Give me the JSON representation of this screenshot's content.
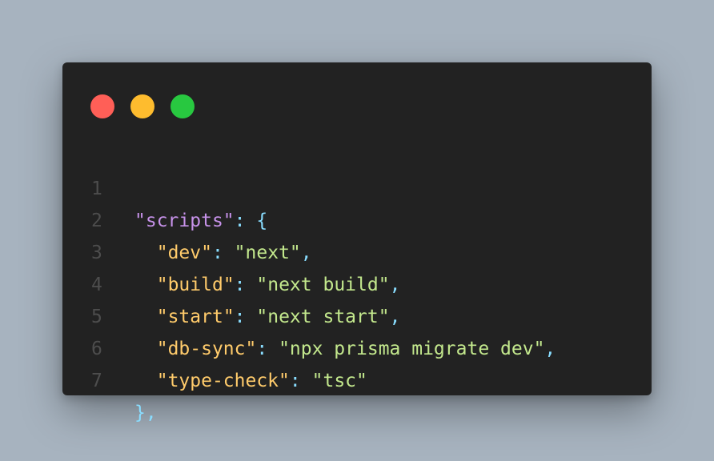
{
  "window": {
    "colors": {
      "background": "#222222",
      "page_background": "#a7b3bf",
      "dot_close": "#ff5f57",
      "dot_minimize": "#febc2e",
      "dot_maximize": "#28c840"
    }
  },
  "code": {
    "lines": [
      {
        "number": "1",
        "key": "scripts",
        "sep": ": ",
        "value": null,
        "open": "{",
        "comma": ""
      },
      {
        "number": "2",
        "key": "dev",
        "sep": ": ",
        "value": "next",
        "comma": ","
      },
      {
        "number": "3",
        "key": "build",
        "sep": ": ",
        "value": "next build",
        "comma": ","
      },
      {
        "number": "4",
        "key": "start",
        "sep": ": ",
        "value": "next start",
        "comma": ","
      },
      {
        "number": "5",
        "key": "db-sync",
        "sep": ": ",
        "value": "npx prisma migrate dev",
        "comma": ","
      },
      {
        "number": "6",
        "key": "type-check",
        "sep": ": ",
        "value": "tsc",
        "comma": ""
      },
      {
        "number": "7",
        "close": "},"
      }
    ]
  }
}
